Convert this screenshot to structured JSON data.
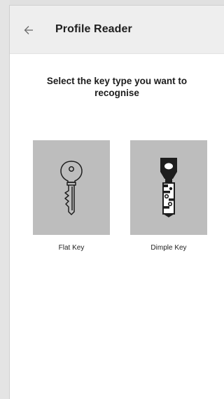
{
  "appbar": {
    "back_icon": "arrow-left-icon",
    "title": "Profile Reader"
  },
  "prompt": {
    "line1": "Select the key type you want to",
    "line2": "recognise"
  },
  "options": [
    {
      "label": "Flat Key",
      "icon": "flat-key-icon"
    },
    {
      "label": "Dimple Key",
      "icon": "dimple-key-icon"
    }
  ],
  "colors": {
    "appbar_bg": "#eeeeee",
    "tile_bg": "#bdbdbd",
    "text": "#202020"
  }
}
